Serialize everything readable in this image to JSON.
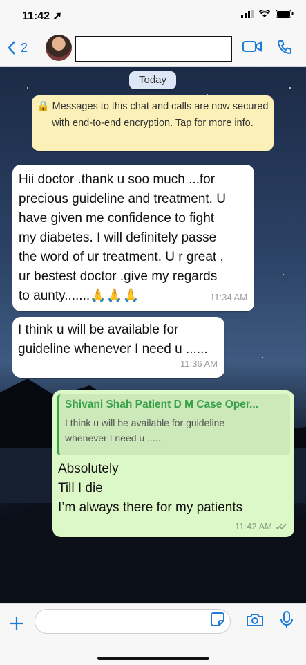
{
  "status": {
    "time": "11:42"
  },
  "nav": {
    "back_count": "2"
  },
  "chat": {
    "date_chip": "Today",
    "encryption_notice": "Messages to this chat and calls are now secured with end-to-end encryption. Tap for more info.",
    "messages": [
      {
        "lines": [
          "Hii doctor .thank u soo much ...for",
          "precious guideline and treatment. U",
          "have given me confidence to fight",
          "my diabetes. I will definitely passe",
          "the word of ur treatment. U r great  ,",
          "ur bestest doctor  .give my regards",
          "to aunty.......🙏🙏🙏"
        ],
        "time": "11:34 AM"
      },
      {
        "lines": [
          "I think u will be available  for",
          "guideline whenever I need u ......"
        ],
        "time": "11:36 AM"
      }
    ],
    "reply": {
      "quoted_name": "Shivani Shah Patient D M Case Oper...",
      "quoted_lines": [
        "I think u will be available  for guideline",
        "whenever I need u ......"
      ],
      "lines": [
        "Absolutely",
        "Till I die",
        "I’m always there for my patients"
      ],
      "time": "11:42 AM"
    }
  },
  "colors": {
    "accent": "#1f7bd8",
    "outgoing": "#dcf8c6",
    "notice": "#fbf0b8"
  }
}
